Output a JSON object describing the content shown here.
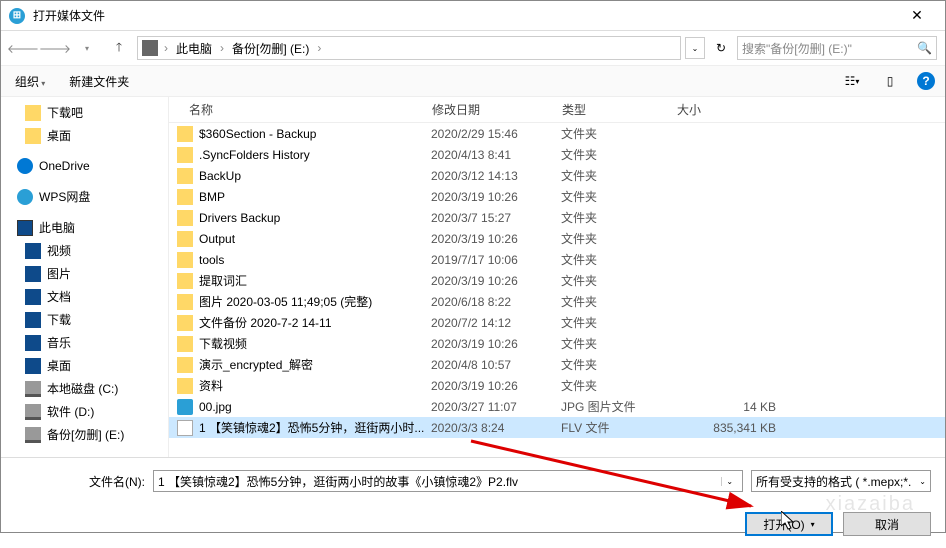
{
  "title": "打开媒体文件",
  "breadcrumb": {
    "pc": "此电脑",
    "drive": "备份[勿删] (E:)"
  },
  "search_placeholder": "搜索\"备份[勿删] (E:)\"",
  "toolbar": {
    "organize": "组织",
    "newfolder": "新建文件夹"
  },
  "sidebar": {
    "downba": "下载吧",
    "desktop1": "桌面",
    "onedrive": "OneDrive",
    "wps": "WPS网盘",
    "thispc": "此电脑",
    "video": "视频",
    "pictures": "图片",
    "documents": "文档",
    "downloads": "下载",
    "music": "音乐",
    "desktop2": "桌面",
    "localc": "本地磁盘 (C:)",
    "softd": "软件 (D:)",
    "backupe": "备份[勿删] (E:)"
  },
  "columns": {
    "name": "名称",
    "date": "修改日期",
    "type": "类型",
    "size": "大小"
  },
  "type_folder": "文件夹",
  "type_jpg": "JPG 图片文件",
  "type_flv": "FLV 文件",
  "files": [
    {
      "name": "$360Section - Backup",
      "date": "2020/2/29 15:46",
      "t": "folder",
      "size": ""
    },
    {
      "name": ".SyncFolders History",
      "date": "2020/4/13 8:41",
      "t": "folder",
      "size": ""
    },
    {
      "name": "BackUp",
      "date": "2020/3/12 14:13",
      "t": "folder",
      "size": ""
    },
    {
      "name": "BMP",
      "date": "2020/3/19 10:26",
      "t": "folder",
      "size": ""
    },
    {
      "name": "Drivers Backup",
      "date": "2020/3/7 15:27",
      "t": "folder",
      "size": ""
    },
    {
      "name": "Output",
      "date": "2020/3/19 10:26",
      "t": "folder",
      "size": ""
    },
    {
      "name": "tools",
      "date": "2019/7/17 10:06",
      "t": "folder",
      "size": ""
    },
    {
      "name": "提取词汇",
      "date": "2020/3/19 10:26",
      "t": "folder",
      "size": ""
    },
    {
      "name": "图片 2020-03-05 11;49;05 (完整)",
      "date": "2020/6/18 8:22",
      "t": "folder",
      "size": ""
    },
    {
      "name": "文件备份 2020-7-2 14-11",
      "date": "2020/7/2 14:12",
      "t": "folder",
      "size": ""
    },
    {
      "name": "下载视频",
      "date": "2020/3/19 10:26",
      "t": "folder",
      "size": ""
    },
    {
      "name": "演示_encrypted_解密",
      "date": "2020/4/8 10:57",
      "t": "folder",
      "size": ""
    },
    {
      "name": "资料",
      "date": "2020/3/19 10:26",
      "t": "folder",
      "size": ""
    },
    {
      "name": "00.jpg",
      "date": "2020/3/27 11:07",
      "t": "jpg",
      "size": "14 KB"
    },
    {
      "name": "1 【笑镇惊魂2】恐怖5分钟，逛街两小时...",
      "date": "2020/3/3 8:24",
      "t": "flv",
      "size": "835,341 KB",
      "sel": true
    }
  ],
  "filename_label": "文件名(N):",
  "filename_value": "1 【笑镇惊魂2】恐怖5分钟，逛街两小时的故事《小镇惊魂2》P2.flv",
  "filter_text": "所有受支持的格式 ( *.mepx;*.",
  "open_btn": "打开(O)",
  "cancel_btn": "取消",
  "watermark": "xiazaiba"
}
